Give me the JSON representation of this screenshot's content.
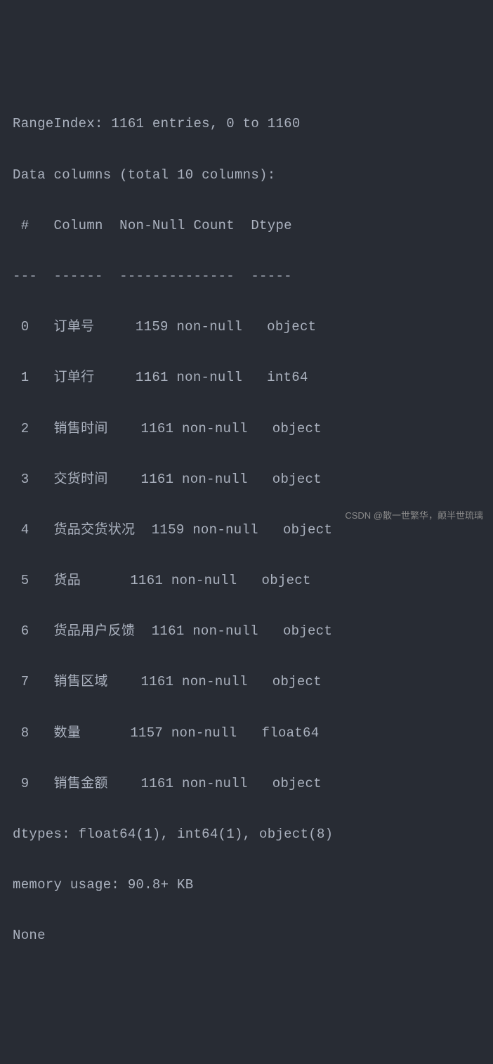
{
  "header": {
    "rangeIndex": "RangeIndex: 1161 entries, 0 to 1160",
    "dataColumns": "Data columns (total 10 columns):",
    "columnHeader": " #   Column  Non-Null Count  Dtype  ",
    "separator": "---  ------  --------------  -----  "
  },
  "rows": [
    " 0   订单号     1159 non-null   object ",
    " 1   订单行     1161 non-null   int64  ",
    " 2   销售时间    1161 non-null   object ",
    " 3   交货时间    1161 non-null   object ",
    " 4   货品交货状况  1159 non-null   object ",
    " 5   货品      1161 non-null   object ",
    " 6   货品用户反馈  1161 non-null   object ",
    " 7   销售区域    1161 non-null   object ",
    " 8   数量      1157 non-null   float64",
    " 9   销售金额    1161 non-null   object "
  ],
  "footer": {
    "dtypes": "dtypes: float64(1), int64(1), object(8)",
    "memory": "memory usage: 90.8+ KB",
    "none": "None"
  },
  "watermark": "CSDN @散一世繁华，颠半世琉璃"
}
